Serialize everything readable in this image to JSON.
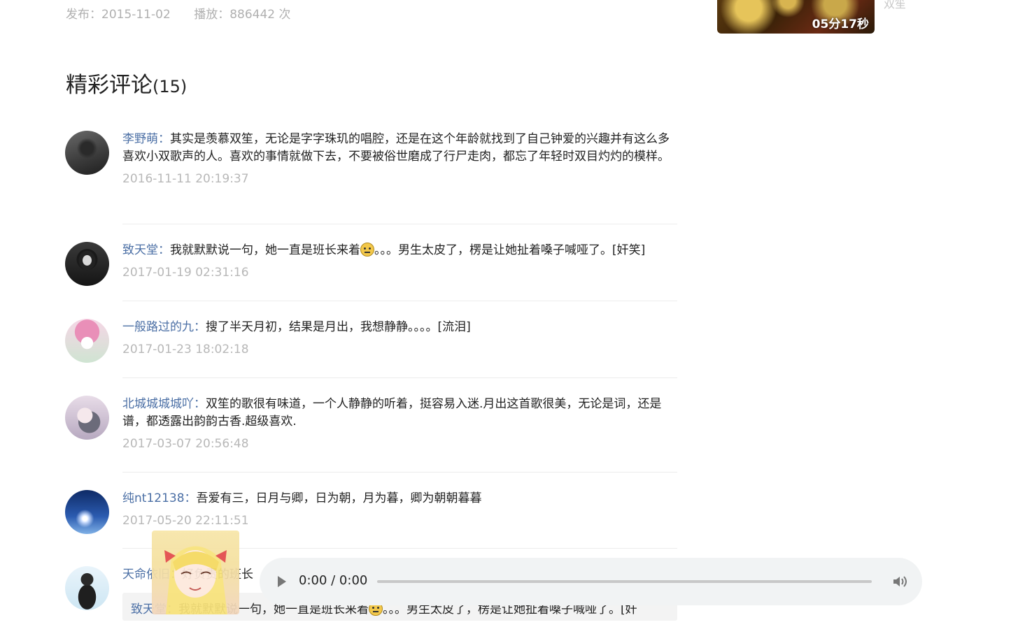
{
  "meta": {
    "publish": "发布：2015-11-02",
    "plays": "播放：886442 次"
  },
  "side": {
    "duration": "05分17秒",
    "label": "双笙"
  },
  "section": {
    "title": "精彩评论",
    "count": "(15)"
  },
  "comments": [
    {
      "user": "李野萌",
      "sep": "：",
      "text": "其实是羡慕双笙，无论是字字珠玑的唱腔，还是在这个年龄就找到了自己钟爱的兴趣并有这么多喜欢小双歌声的人。喜欢的事情就做下去，不要被俗世磨成了行尸走肉，都忘了年轻时双目灼灼的模样。",
      "time": "2016-11-11 20:19:37"
    },
    {
      "user": "致天堂",
      "sep": "：",
      "text_a": "我就默默说一句，她一直是班长来着",
      "text_b": "。。。男生太皮了，楞是让她扯着嗓子喊哑了。[奸笑]",
      "time": "2017-01-19 02:31:16"
    },
    {
      "user": "一般路过的九",
      "sep": "：",
      "text": "搜了半天月初，结果是月出，我想静静。。。。[流泪]",
      "time": "2017-01-23 18:02:18"
    },
    {
      "user": "北城城城城吖",
      "sep": "：",
      "text": "双笙的歌很有味道，一个人静静的听着，挺容易入迷.月出这首歌很美，无论是词，还是谱，都透露出韵韵古香.超级喜欢.",
      "time": "2017-03-07 20:56:48"
    },
    {
      "user": "纯nt12138",
      "sep": "：",
      "text": "吾爱有三，日月与卿，日为朝，月为暮，卿为朝朝暮暮",
      "time": "2017-05-20 22:11:51"
    },
    {
      "user": "天命依旧",
      "sep": "：",
      "text": "好负责的班长"
    }
  ],
  "reply": {
    "user": "致天堂",
    "sep": "：",
    "text_a": "我就默默说一句，她一直是班长来着",
    "text_b": "。。。男生太皮了，楞是让她扯着嗓子喊哑了。[奸"
  },
  "player": {
    "time": "0:00 / 0:00"
  }
}
